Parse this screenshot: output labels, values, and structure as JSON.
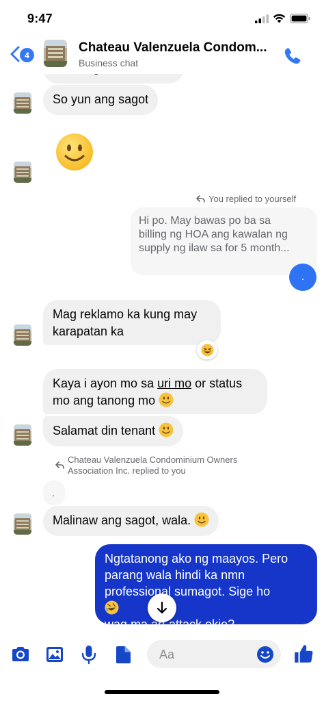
{
  "status": {
    "time": "9:47"
  },
  "header": {
    "unread_count": "4",
    "title": "Chateau Valenzuela Condom...",
    "subtitle": "Business chat"
  },
  "messages": {
    "partial_top": "dibu nag rereklamo ka",
    "m1": "So yun ang sagot",
    "reply_header_1": "You replied to yourself",
    "quoted_1": [
      "Hi po. May bawas po ba sa",
      "billing ng HOA ang kawalan ng",
      "supply ng ilaw sa for 5 month..."
    ],
    "dot_message": ".",
    "m2_line1": "Mag reklamo ka kung may",
    "m2_line2": "karapatan ka",
    "m3_line1_a": "Kaya i ayon mo sa ",
    "m3_line1_u": "uri mo",
    "m3_line1_b": " or status",
    "m3_line2": "mo ang tanong mo",
    "m4": "Salamat din tenant",
    "reply_header_2_line1": "Chateau Valenzuela Condominium Owners",
    "reply_header_2_line2": "Association Inc. replied to you",
    "quoted_2": ".",
    "m5": "Malinaw ang sagot, wala.",
    "sent": [
      "Ngtatanong ako ng maayos. Pero",
      "parang wala hindi ka nmn",
      "professional sumagot. Sige ho",
      "wag ma        art attack okie?"
    ]
  },
  "composer": {
    "placeholder": "Aa"
  },
  "colors": {
    "accent": "#3478f6",
    "sent_bubble": "#1536c9",
    "received_bubble": "#f0f0f0"
  },
  "icons": [
    "back-chevron-icon",
    "phone-icon",
    "camera-icon",
    "image-icon",
    "microphone-icon",
    "document-icon",
    "emoji-icon",
    "thumbs-up-icon",
    "arrow-down-icon",
    "reply-arrow-icon"
  ]
}
